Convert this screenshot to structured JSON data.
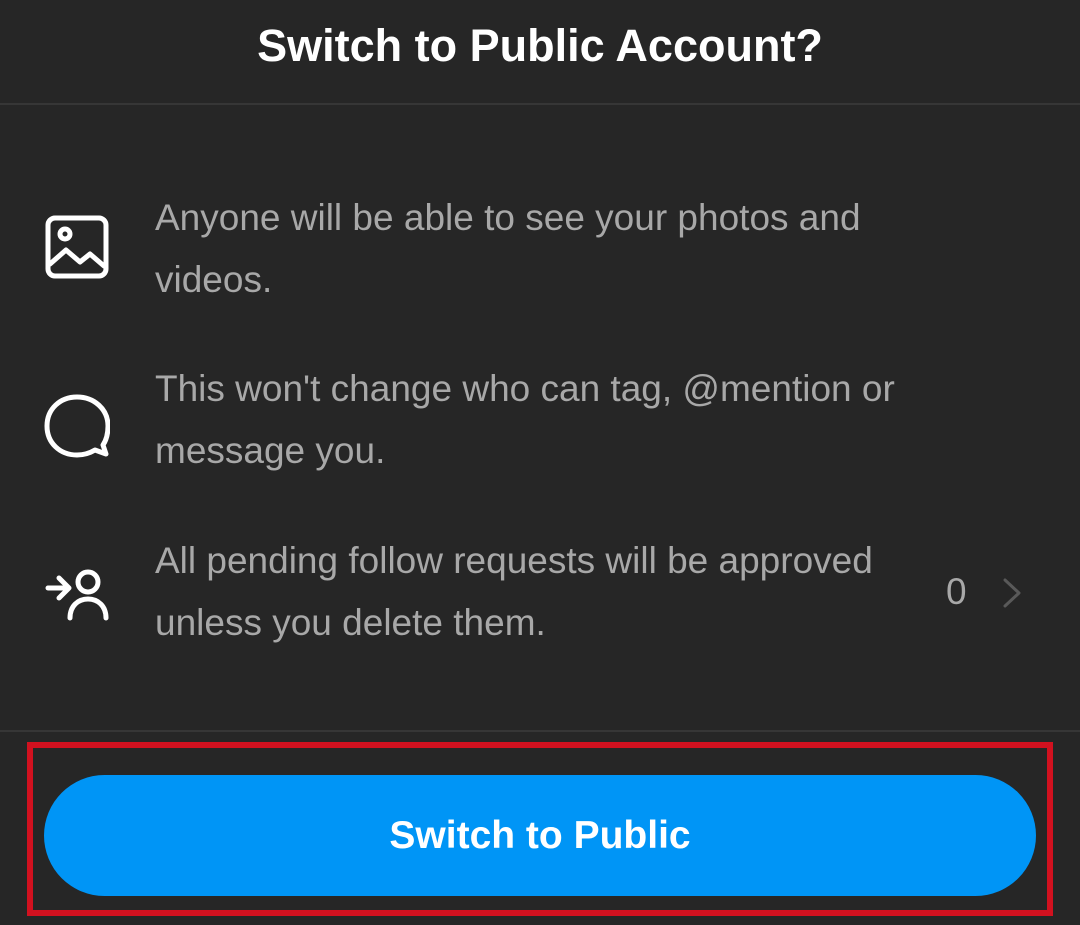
{
  "dialog": {
    "title": "Switch to Public Account?"
  },
  "info_rows": [
    {
      "icon": "photo-icon",
      "text": "Anyone will be able to see your photos and videos."
    },
    {
      "icon": "message-bubble-icon",
      "text": "This won't change who can tag, @mention or message you."
    },
    {
      "icon": "follow-request-icon",
      "text": "All pending follow requests will be approved unless you delete them.",
      "pending_count": "0"
    }
  ],
  "actions": {
    "switch_label": "Switch to Public"
  },
  "colors": {
    "background": "#262626",
    "text_secondary": "#a8a8a8",
    "primary_button": "#0095f6",
    "highlight_outline": "#d1111f"
  }
}
